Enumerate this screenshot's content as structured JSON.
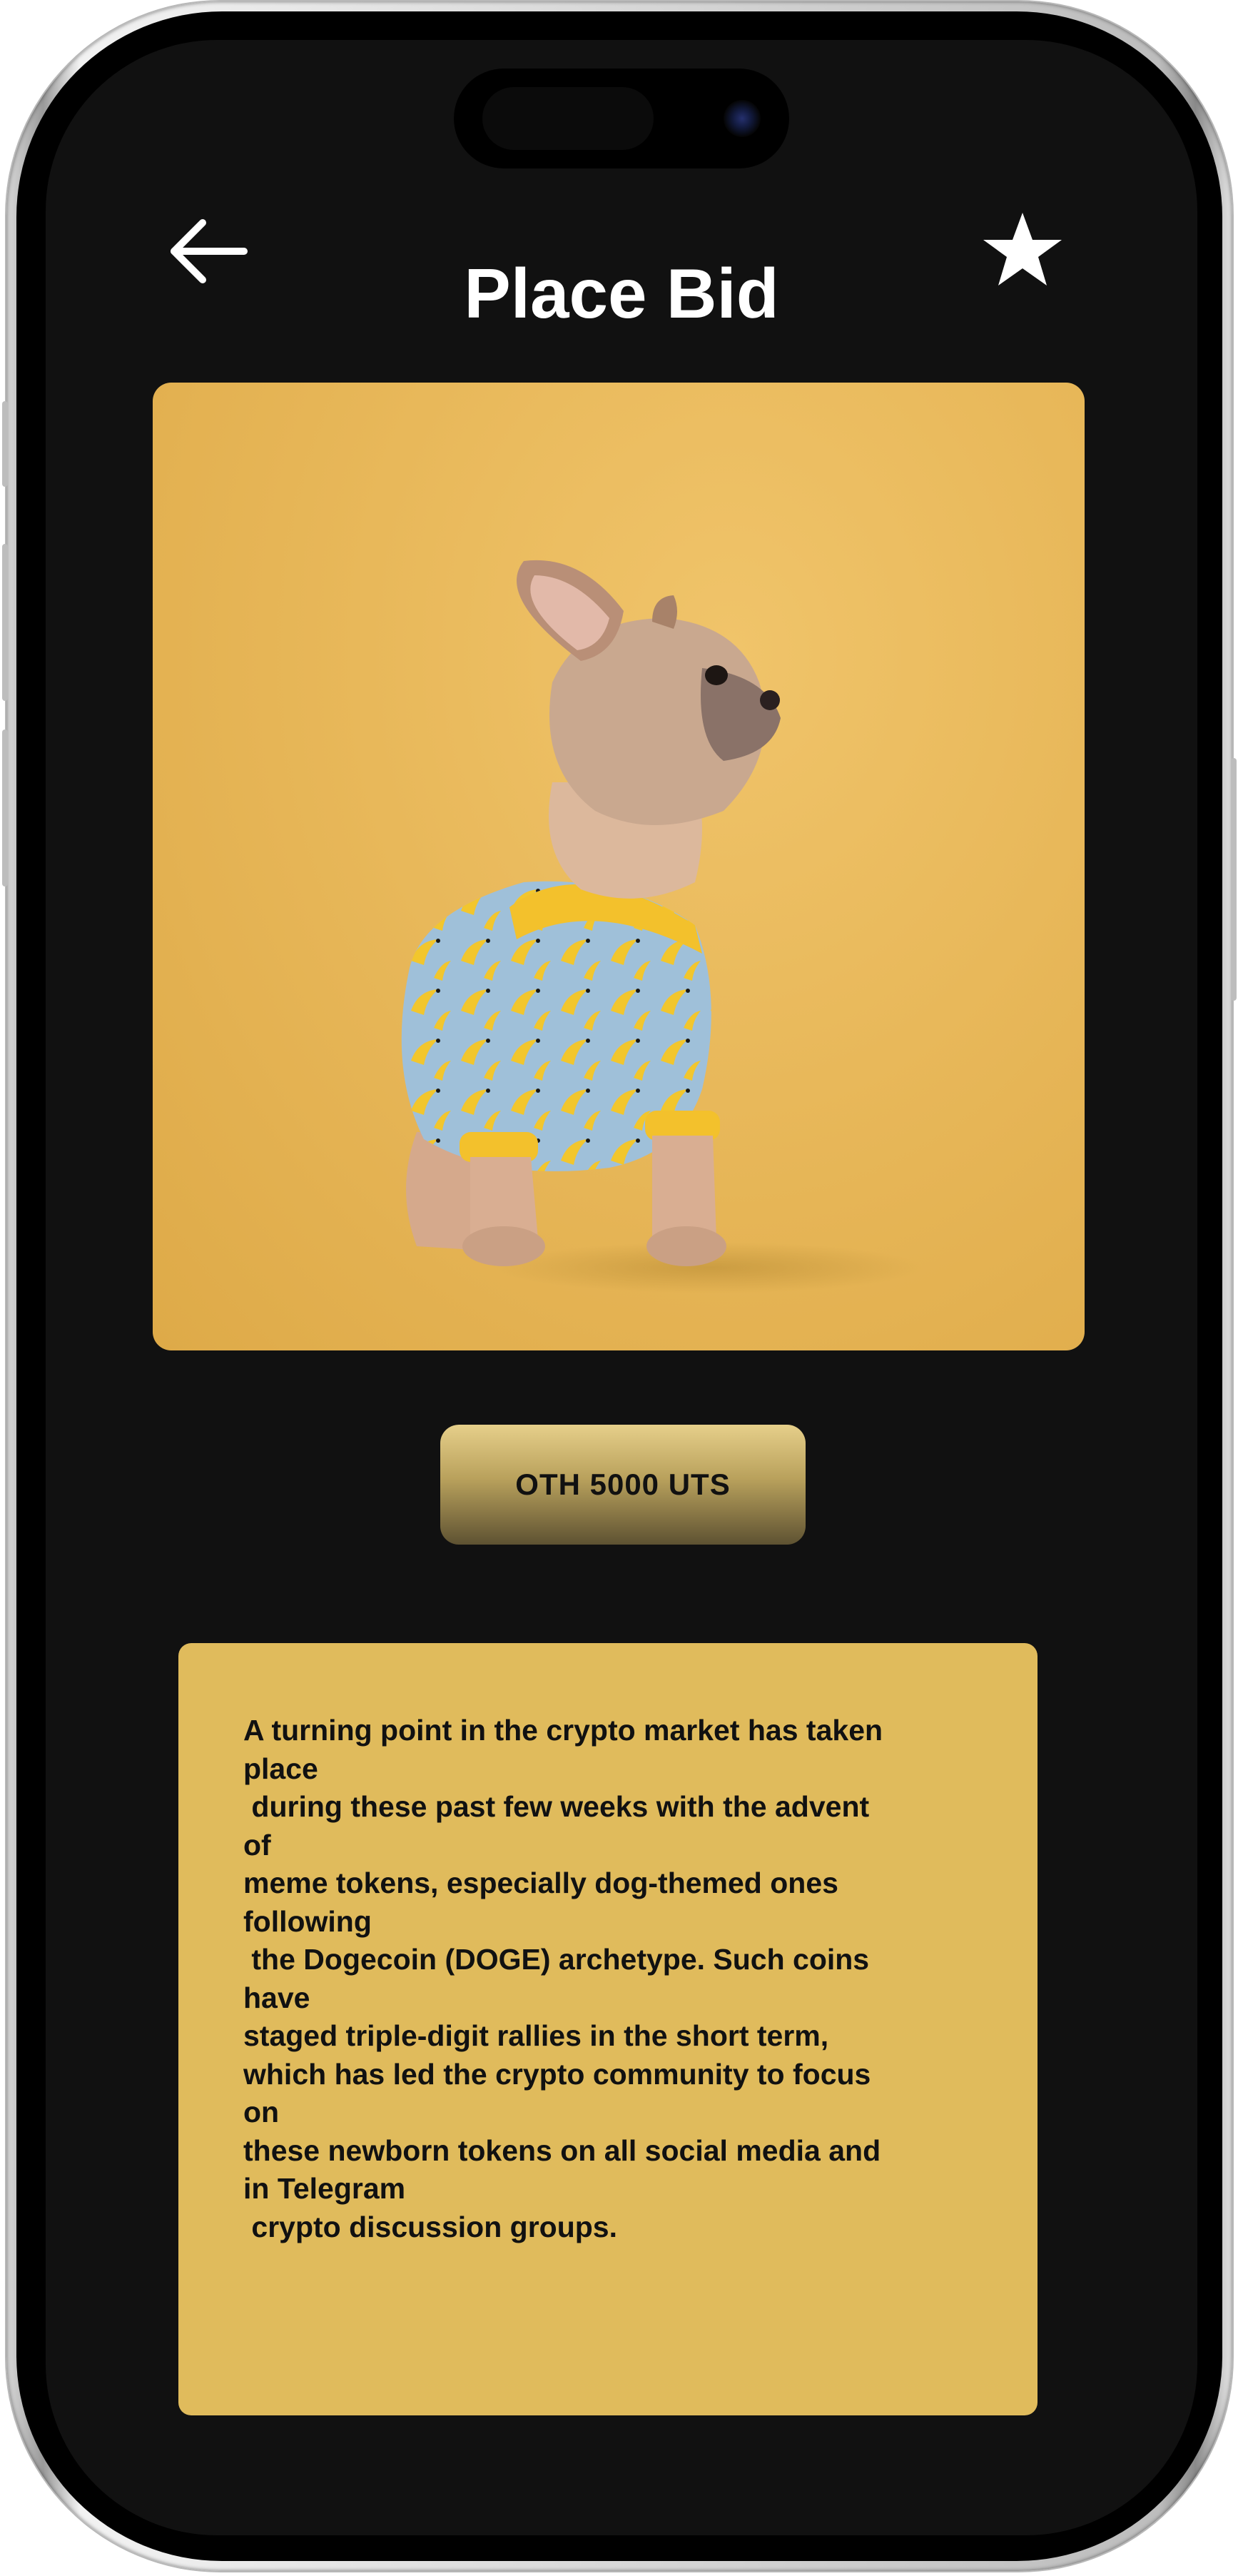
{
  "header": {
    "title": "Place Bid",
    "back_icon": "arrow-left-icon",
    "favorite_icon": "star-icon"
  },
  "artwork": {
    "subject": "french-bulldog-in-banana-shirt",
    "background_color": "#e8b85a"
  },
  "price": {
    "label": "OTH 5000 UTS"
  },
  "description": {
    "text": "A turning point in the crypto market has taken\nplace\n during these past few weeks with the advent\nof\nmeme tokens, especially dog-themed ones\nfollowing\n the Dogecoin (DOGE) archetype. Such coins\nhave\nstaged triple-digit rallies in the short term,\nwhich has led the crypto community to focus\non\nthese newborn tokens on all social media and\nin Telegram\n crypto discussion groups."
  },
  "colors": {
    "screen_background": "#111111",
    "accent_gold": "#e0bb5c",
    "text_light": "#ffffff",
    "text_dark": "#111111"
  }
}
